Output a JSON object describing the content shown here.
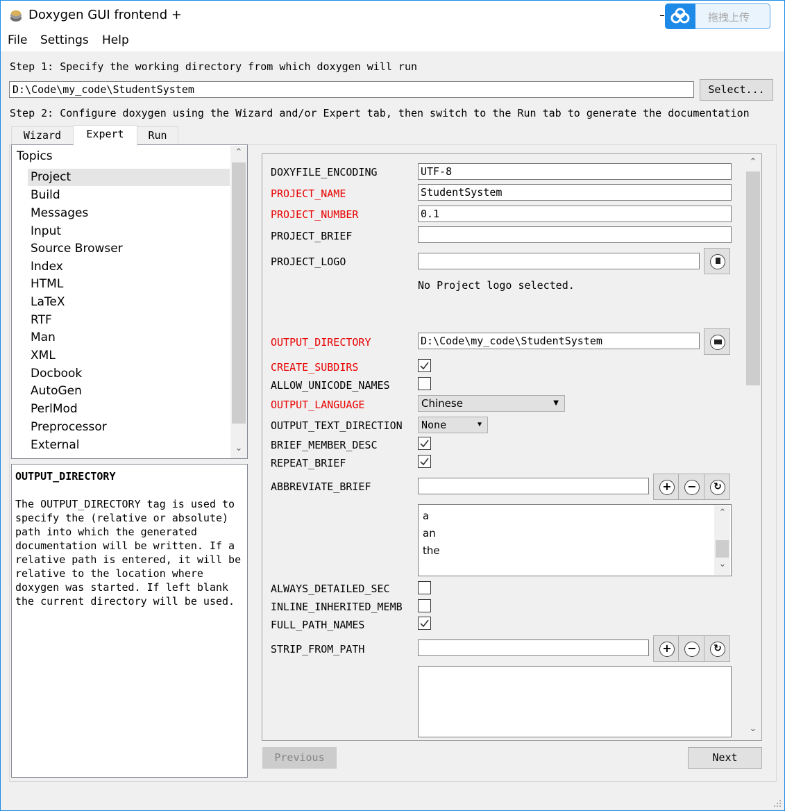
{
  "window": {
    "title": "Doxygen GUI frontend +",
    "upload_label": "拖拽上传"
  },
  "menu": [
    "File",
    "Settings",
    "Help"
  ],
  "step1": {
    "text": "Step 1: Specify the working directory from which doxygen will run",
    "workdir": "D:\\Code\\my_code\\StudentSystem",
    "select_label": "Select..."
  },
  "step2": {
    "text": "Step 2: Configure doxygen using the Wizard and/or Expert tab, then switch to the Run tab to generate the documentation"
  },
  "tabs": [
    {
      "label": "Wizard",
      "active": false
    },
    {
      "label": "Expert",
      "active": true
    },
    {
      "label": "Run",
      "active": false
    }
  ],
  "topics": {
    "heading": "Topics",
    "selected": "Project",
    "items": [
      "Project",
      "Build",
      "Messages",
      "Input",
      "Source Browser",
      "Index",
      "HTML",
      "LaTeX",
      "RTF",
      "Man",
      "XML",
      "Docbook",
      "AutoGen",
      "PerlMod",
      "Preprocessor",
      "External"
    ]
  },
  "help": {
    "title": "OUTPUT_DIRECTORY",
    "text": "The OUTPUT_DIRECTORY tag is used to specify the (relative or absolute) path into which the generated documentation will be written. If a relative path is entered, it will be relative to the location where doxygen was started. If left blank the current directory will be used."
  },
  "settings": {
    "doxyfile_encoding": {
      "label": "DOXYFILE_ENCODING",
      "value": "UTF-8"
    },
    "project_name": {
      "label": "PROJECT_NAME",
      "value": "StudentSystem"
    },
    "project_number": {
      "label": "PROJECT_NUMBER",
      "value": "0.1"
    },
    "project_brief": {
      "label": "PROJECT_BRIEF",
      "value": ""
    },
    "project_logo": {
      "label": "PROJECT_LOGO",
      "value": "",
      "note": "No Project logo selected."
    },
    "output_directory": {
      "label": "OUTPUT_DIRECTORY",
      "value": "D:\\Code\\my_code\\StudentSystem"
    },
    "create_subdirs": {
      "label": "CREATE_SUBDIRS",
      "checked": true
    },
    "allow_unicode_names": {
      "label": "ALLOW_UNICODE_NAMES",
      "checked": false
    },
    "output_language": {
      "label": "OUTPUT_LANGUAGE",
      "value": "Chinese"
    },
    "output_text_direction": {
      "label": "OUTPUT_TEXT_DIRECTION",
      "value": "None"
    },
    "brief_member_desc": {
      "label": "BRIEF_MEMBER_DESC",
      "checked": true
    },
    "repeat_brief": {
      "label": "REPEAT_BRIEF",
      "checked": true
    },
    "abbreviate_brief": {
      "label": "ABBREVIATE_BRIEF",
      "value": "",
      "items": [
        "a",
        "an",
        "the"
      ]
    },
    "always_detailed_sec": {
      "label": "ALWAYS_DETAILED_SEC",
      "checked": false
    },
    "inline_inherited_memb": {
      "label": "INLINE_INHERITED_MEMB",
      "checked": false
    },
    "full_path_names": {
      "label": "FULL_PATH_NAMES",
      "checked": true
    },
    "strip_from_path": {
      "label": "STRIP_FROM_PATH",
      "value": ""
    }
  },
  "nav": {
    "previous": "Previous",
    "next": "Next"
  },
  "colors": {
    "required_label": "#e80000",
    "accent": "#1a8ae4"
  }
}
